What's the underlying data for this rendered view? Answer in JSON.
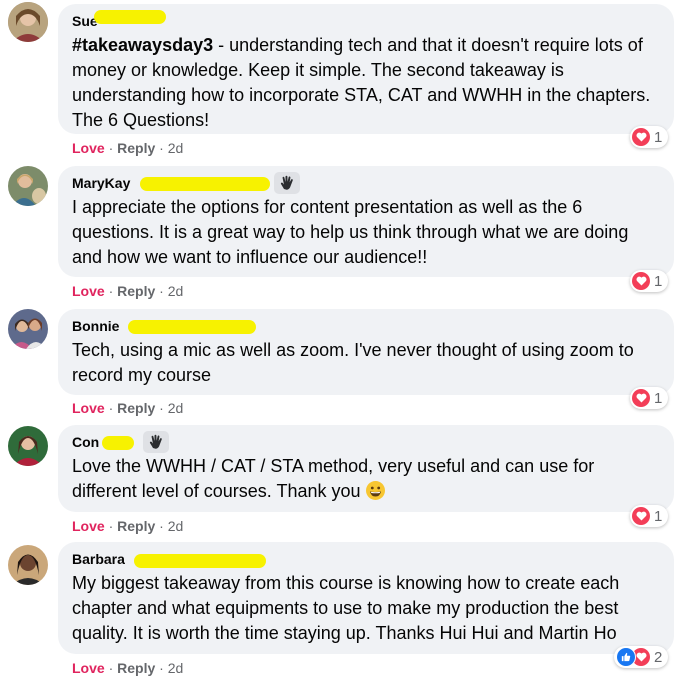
{
  "comments": [
    {
      "author": "Sue",
      "hashtag": "#takeawaysday3",
      "text": " - understanding tech and that it doesn't require lots of money or knowledge. Keep it simple. The second takeaway is understanding how to incorporate STA, CAT and WWHH in the chapters. The 6 Questions!",
      "reaction_count": "1",
      "online": true
    },
    {
      "author": "MaryKay",
      "text": "I appreciate the options for content presentation as well as the 6 questions. It is a great way to help us think through what we are doing and how we want to influence our audience!!",
      "reaction_count": "1",
      "online": true
    },
    {
      "author": "Bonnie",
      "text": "Tech, using a mic as well as zoom. I've never thought of using zoom to record my course",
      "reaction_count": "1"
    },
    {
      "author": "Con",
      "text": "Love the WWHH / CAT / STA method, very useful and can use for different level of courses. Thank you",
      "reaction_count": "1"
    },
    {
      "author": "Barbara",
      "text": "My biggest takeaway from this course is knowing how to create each chapter and what equipments to use to make my production the best quality. It is worth the time staying up. Thanks Hui Hui and Martin Ho",
      "reaction_count": "2"
    }
  ],
  "actions": {
    "love": "Love",
    "separator": "·",
    "reply": "Reply",
    "time": "2d"
  },
  "colors": {
    "love": "#e0245e",
    "bubble": "#f0f2f5",
    "muted": "#65676b",
    "redaction": "#f7f200",
    "heart": "#f33e58",
    "like": "#1877f2",
    "online": "#31a24c"
  },
  "icons": {
    "reaction_heart": "heart-icon",
    "reaction_like": "like-icon",
    "wave": "wave-icon",
    "emoji": "grinning-face-icon"
  }
}
